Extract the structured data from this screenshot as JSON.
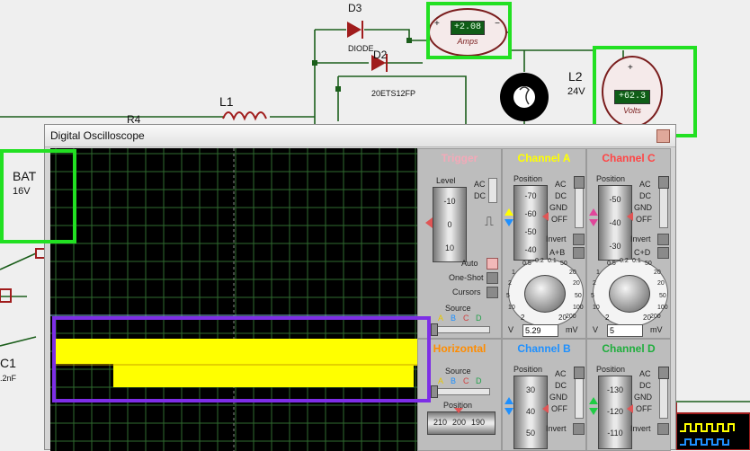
{
  "schematic": {
    "labels": {
      "d3": "D3",
      "diode": "DIODE",
      "d2": "D2",
      "d2_part": "20ETS12FP",
      "l1": "L1",
      "l2": "L2",
      "l2_value": "24V",
      "r4": "R4",
      "bat": "BAT",
      "bat_value": "16V",
      "c1": "C1",
      "c1_value": ".2nF"
    },
    "ammeter": {
      "value": "+2.08",
      "unit": "Amps",
      "plus": "+",
      "minus": "−"
    },
    "voltmeter": {
      "value": "+62.3",
      "unit": "Volts",
      "plus": "+"
    }
  },
  "scope": {
    "title": "Digital Oscilloscope",
    "trace_colors": {
      "a": "#ffff00",
      "b": "#1e90ff",
      "c": "#ff2a2a",
      "d": "#1fcc44",
      "ref": "#7fb3d9"
    },
    "trigger": {
      "title": "Trigger",
      "level_label": "Level",
      "level_ticks": [
        "-10",
        "0",
        "10"
      ],
      "ac": "AC",
      "dc": "DC",
      "auto": "Auto",
      "one_shot": "One-Shot",
      "cursors": "Cursors",
      "source_label": "Source",
      "sources": [
        "A",
        "B",
        "C",
        "D"
      ]
    },
    "channel_a": {
      "title": "Channel A",
      "position_label": "Position",
      "ticks": [
        "-70",
        "-60",
        "-50",
        "-40"
      ],
      "modes": [
        "AC",
        "DC",
        "GND",
        "OFF"
      ],
      "invert": "Invert",
      "combine": "A+B",
      "scale": [
        "0.5",
        "0.2",
        "0.1",
        "50",
        "20",
        "1",
        "2",
        "5",
        "10",
        "20",
        "50",
        "100",
        "200"
      ],
      "unit_v": "V",
      "unit_mv": "mV",
      "edge_2": "2",
      "edge_20": "20",
      "value": "5.29"
    },
    "channel_c": {
      "title": "Channel C",
      "position_label": "Position",
      "ticks": [
        "-50",
        "-40",
        "-30"
      ],
      "modes": [
        "AC",
        "DC",
        "GND",
        "OFF"
      ],
      "invert": "Invert",
      "combine": "C+D",
      "scale": [
        "0.5",
        "0.2",
        "0.1",
        "50",
        "20",
        "1",
        "2",
        "5",
        "10",
        "20",
        "50",
        "100",
        "200"
      ],
      "unit_v": "V",
      "unit_mv": "mV",
      "edge_2": "2",
      "edge_20": "20",
      "value": "5"
    },
    "horizontal": {
      "title": "Horizontal",
      "source_label": "Source",
      "sources": [
        "A",
        "B",
        "C",
        "D"
      ],
      "position_label": "Position",
      "ticks": [
        "210",
        "200",
        "190"
      ]
    },
    "channel_b": {
      "title": "Channel B",
      "position_label": "Position",
      "ticks": [
        "30",
        "40",
        "50"
      ],
      "modes": [
        "AC",
        "DC",
        "GND",
        "OFF"
      ],
      "invert": "Invert"
    },
    "channel_d": {
      "title": "Channel D",
      "position_label": "Position",
      "ticks": [
        "-130",
        "-120",
        "-110"
      ],
      "modes": [
        "AC",
        "DC",
        "GND",
        "OFF"
      ],
      "invert": "Invert"
    }
  }
}
